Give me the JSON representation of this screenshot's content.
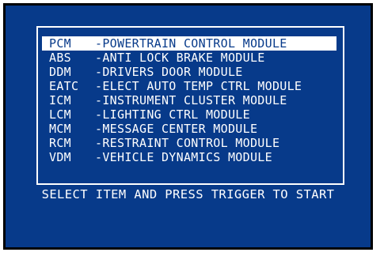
{
  "menu": {
    "selected_index": 0,
    "items": [
      {
        "code": "PCM",
        "desc": "-POWERTRAIN CONTROL MODULE"
      },
      {
        "code": "ABS",
        "desc": "-ANTI LOCK BRAKE MODULE"
      },
      {
        "code": "DDM",
        "desc": "-DRIVERS DOOR MODULE"
      },
      {
        "code": "EATC",
        "desc": "-ELECT AUTO TEMP CTRL MODULE"
      },
      {
        "code": "ICM",
        "desc": "-INSTRUMENT CLUSTER MODULE"
      },
      {
        "code": "LCM",
        "desc": "-LIGHTING CTRL MODULE"
      },
      {
        "code": "MCM",
        "desc": "-MESSAGE CENTER MODULE"
      },
      {
        "code": "RCM",
        "desc": "-RESTRAINT CONTROL MODULE"
      },
      {
        "code": "VDM",
        "desc": "-VEHICLE DYNAMICS MODULE"
      }
    ]
  },
  "prompt": "SELECT ITEM AND PRESS TRIGGER TO START",
  "colors": {
    "screen_background": "#073a8a",
    "text": "#ffffff",
    "selection_highlight": "#ffffff",
    "bezel": "#000000"
  }
}
